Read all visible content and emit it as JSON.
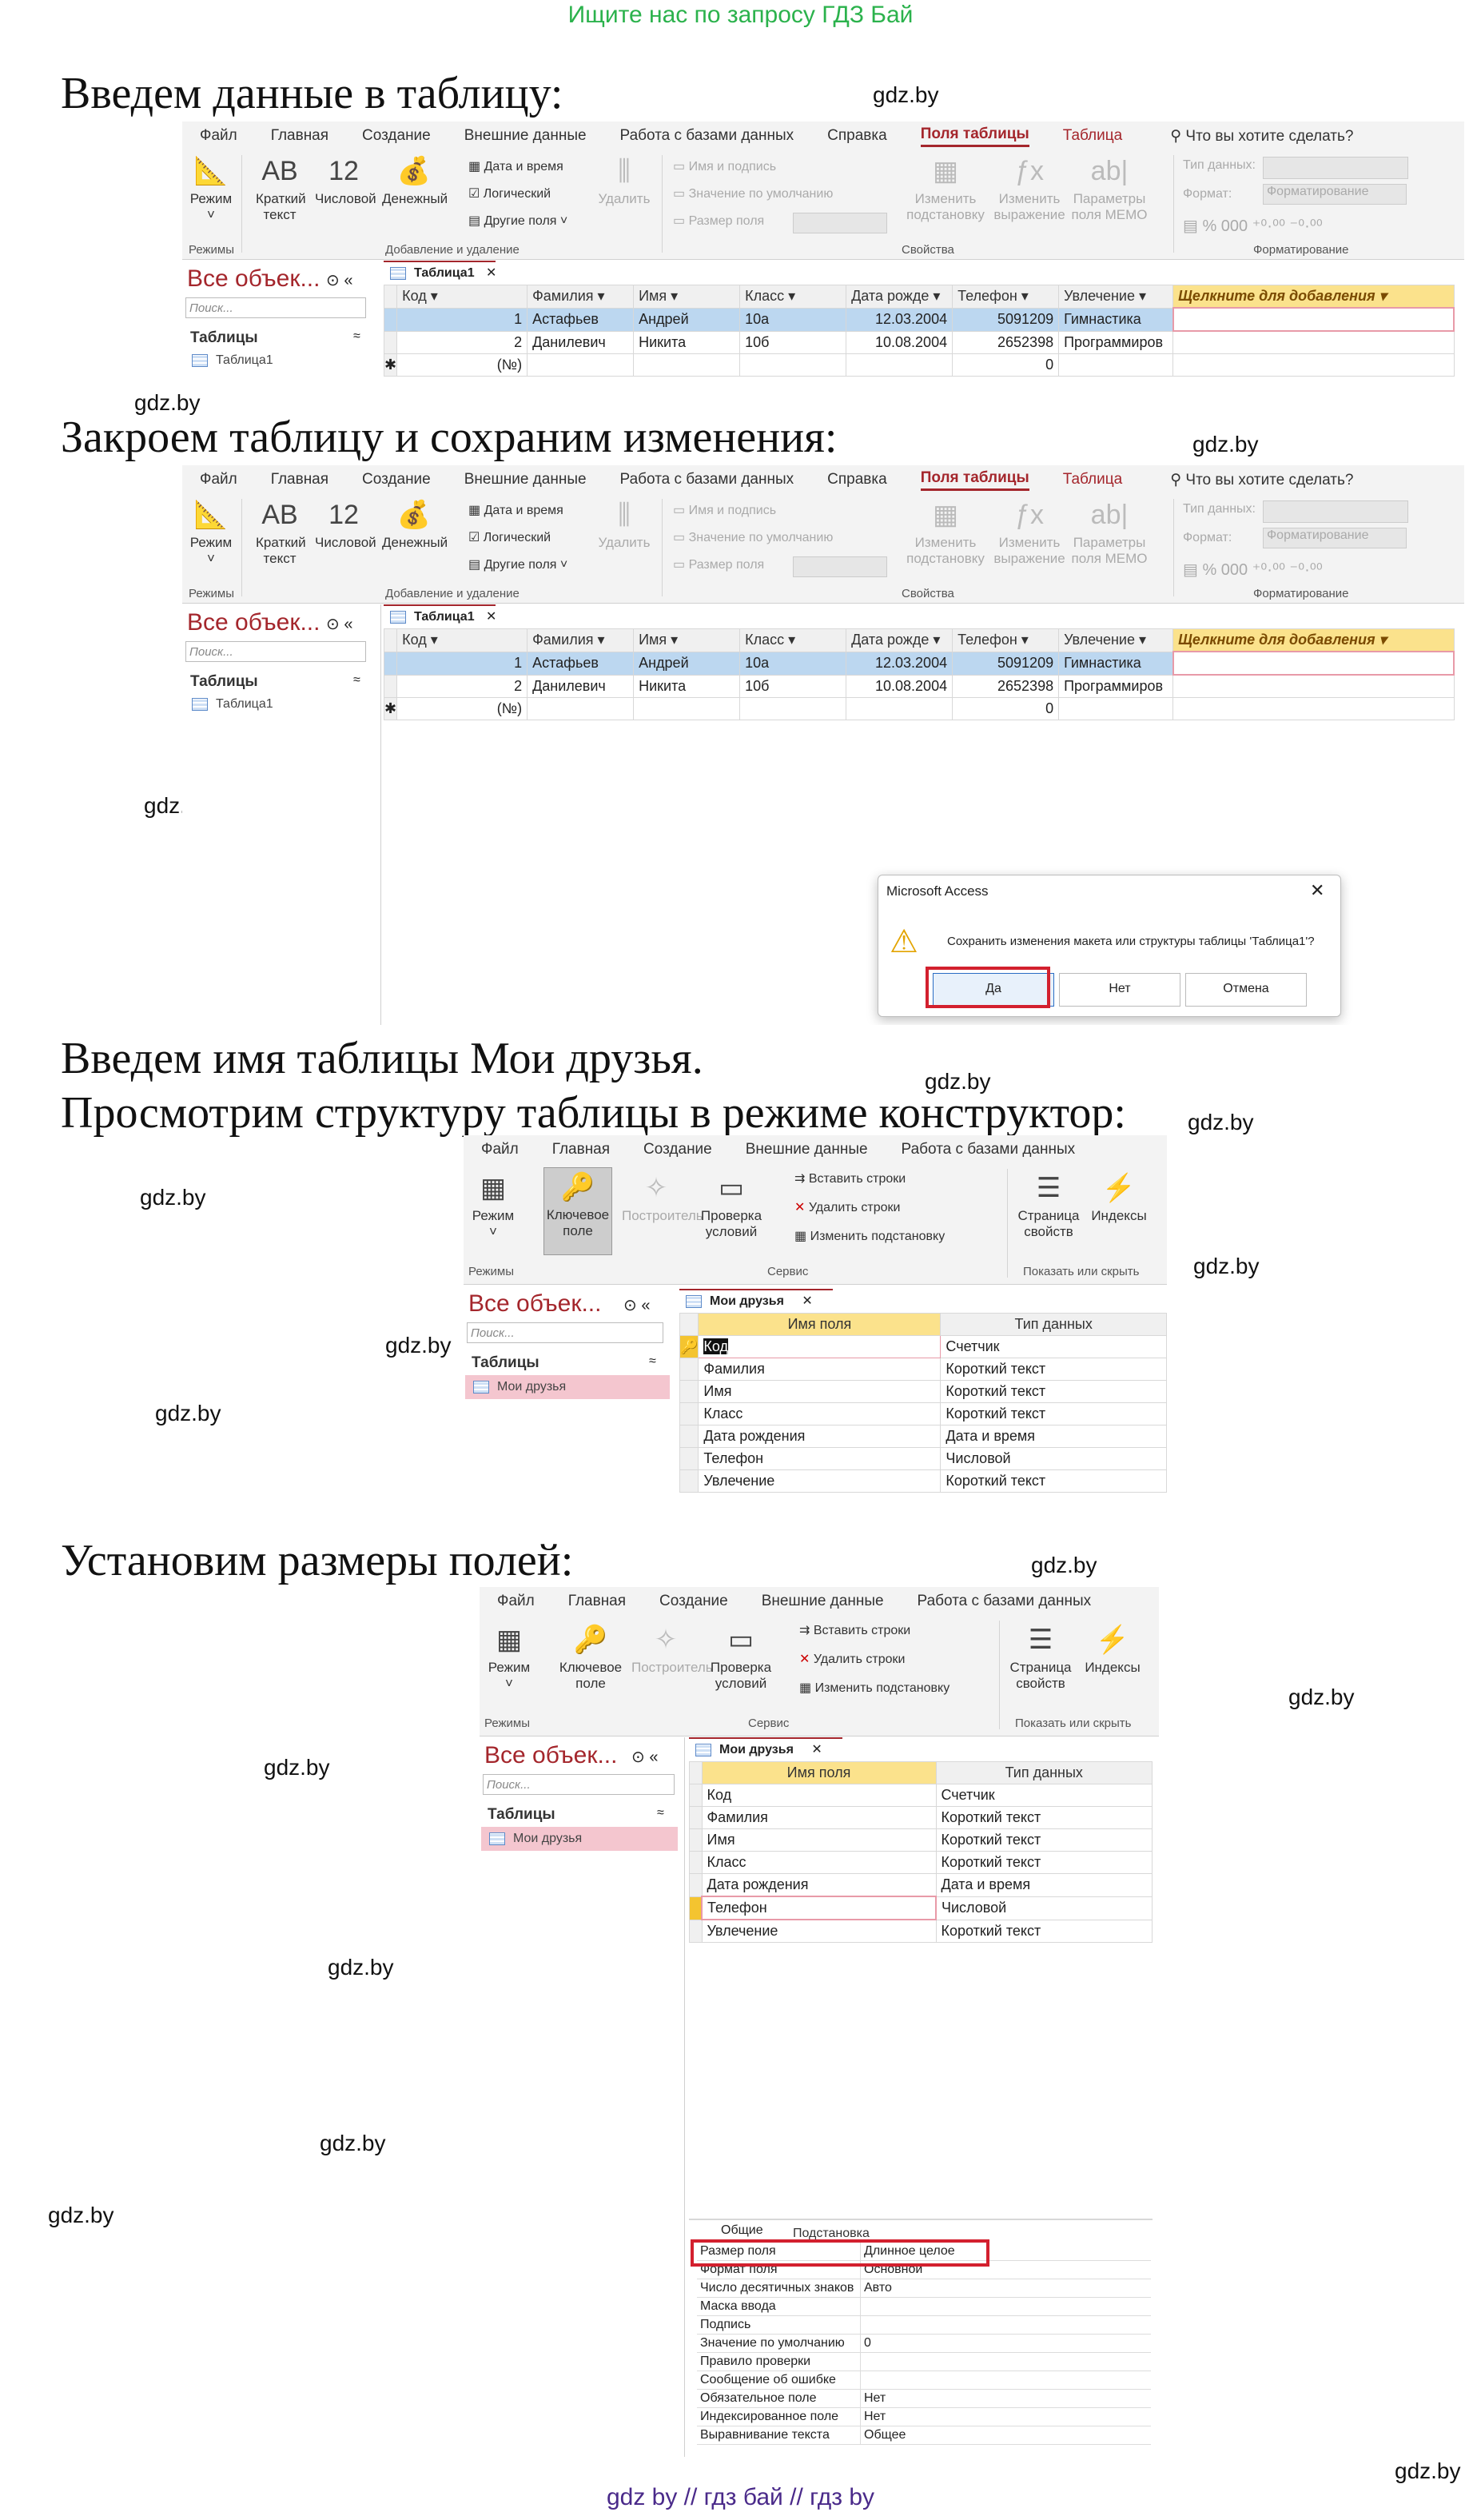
{
  "banner": "Ищите нас по запросу ГДЗ Бай",
  "footer": "gdz by  //  гдз бай  //  гдз by",
  "watermark": "gdz.by",
  "headings": {
    "h1": "Введем данные в таблицу:",
    "h2": "Закроем таблицу и сохраним изменения:",
    "h3": "Введем имя таблицы Мои друзья.",
    "h4": "Просмотрим структуру таблицы в режиме конструктор:",
    "h5": "Установим размеры полей:"
  },
  "ribbon_fields": {
    "menu": [
      "Файл",
      "Главная",
      "Создание",
      "Внешние данные",
      "Работа с базами данных",
      "Справка",
      "Поля таблицы",
      "Таблица"
    ],
    "active_tab": "Поля таблицы",
    "search": "Что вы хотите сделать?",
    "mode": "Режим",
    "groups": {
      "modes": "Режимы",
      "add_delete": "Добавление и удаление",
      "properties": "Свойства",
      "formatting": "Форматирование"
    },
    "buttons": {
      "short_text_icon": "AB",
      "short_text": "Краткий текст",
      "number_icon": "12",
      "number": "Числовой",
      "currency": "Денежный",
      "datetime": "Дата и время",
      "logical": "Логический",
      "other": "Другие поля",
      "delete": "Удалить",
      "name_caption": "Имя и подпись",
      "default_value": "Значение по умолчанию",
      "field_size": "Размер поля",
      "change_lookup": "Изменить подстановку",
      "expression": "Изменить выражение",
      "memo": "Параметры поля MEMO",
      "data_type": "Тип данных:",
      "format": "Формат:",
      "format_value": "Форматирование"
    }
  },
  "ribbon_design": {
    "menu": [
      "Файл",
      "Главная",
      "Создание",
      "Внешние данные",
      "Работа с базами данных"
    ],
    "groups": {
      "modes": "Режимы",
      "service": "Сервис",
      "show_hide": "Показать или скрыть"
    },
    "buttons": {
      "mode": "Режим",
      "key": "Ключевое поле",
      "builder": "Построитель",
      "check": "Проверка условий",
      "insert_rows": "Вставить строки",
      "delete_rows": "Удалить строки",
      "change_lookup": "Изменить подстановку",
      "property_sheet": "Страница свойств",
      "indexes": "Индексы"
    }
  },
  "nav": {
    "title": "Все объек...",
    "search_placeholder": "Поиск...",
    "section": "Таблицы",
    "table1": "Таблица1",
    "friends": "Мои друзья"
  },
  "datasheet": {
    "tab": "Таблица1",
    "columns": [
      "Код",
      "Фамилия",
      "Имя",
      "Класс",
      "Дата рожде",
      "Телефон",
      "Увлечение"
    ],
    "add_column": "Щелкните для добавления",
    "rows": [
      [
        "1",
        "Астафьев",
        "Андрей",
        "10а",
        "12.03.2004",
        "5091209",
        "Гимнастика"
      ],
      [
        "2",
        "Данилевич",
        "Никита",
        "10б",
        "10.08.2004",
        "2652398",
        "Программиров"
      ]
    ],
    "new_row": [
      "(№)",
      "",
      "",
      "",
      "",
      "0",
      ""
    ]
  },
  "dialog": {
    "title": "Microsoft Access",
    "message": "Сохранить изменения макета или структуры таблицы 'Таблица1'?",
    "yes": "Да",
    "no": "Нет",
    "cancel": "Отмена"
  },
  "design": {
    "tab": "Мои друзья",
    "col_name": "Имя поля",
    "col_type": "Тип данных",
    "fields": [
      [
        "Код",
        "Счетчик"
      ],
      [
        "Фамилия",
        "Короткий текст"
      ],
      [
        "Имя",
        "Короткий текст"
      ],
      [
        "Класс",
        "Короткий текст"
      ],
      [
        "Дата рождения",
        "Дата и время"
      ],
      [
        "Телефон",
        "Числовой"
      ],
      [
        "Увлечение",
        "Короткий текст"
      ]
    ]
  },
  "props": {
    "tab_general": "Общие",
    "tab_lookup": "Подстановка",
    "rows": [
      [
        "Размер поля",
        "Длинное целое"
      ],
      [
        "Формат поля",
        "Основной"
      ],
      [
        "Число десятичных знаков",
        "Авто"
      ],
      [
        "Маска ввода",
        ""
      ],
      [
        "Подпись",
        ""
      ],
      [
        "Значение по умолчанию",
        "0"
      ],
      [
        "Правило проверки",
        ""
      ],
      [
        "Сообщение об ошибке",
        ""
      ],
      [
        "Обязательное поле",
        "Нет"
      ],
      [
        "Индексированное поле",
        "Нет"
      ],
      [
        "Выравнивание текста",
        "Общее"
      ]
    ]
  },
  "colors": {
    "accent": "#a4262c",
    "selection": "#bcd7f0",
    "highlight": "#d3202e",
    "banner": "#2bb24c"
  }
}
